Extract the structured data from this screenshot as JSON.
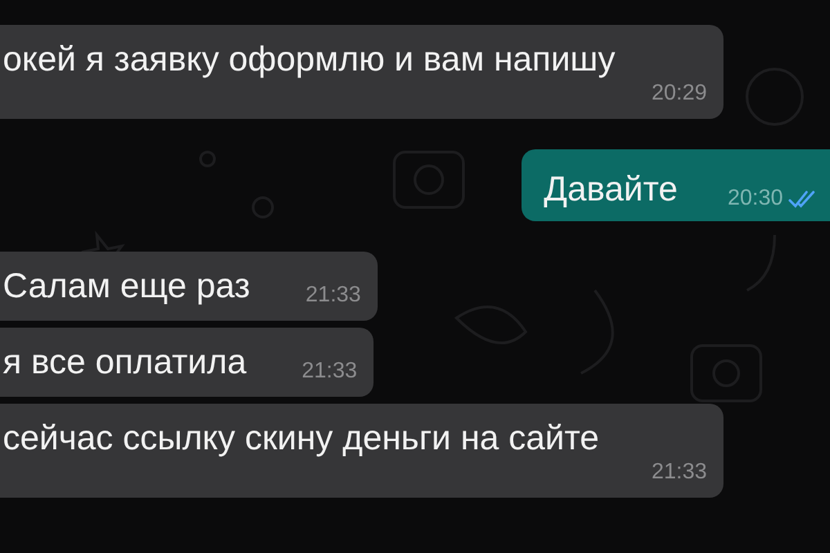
{
  "messages": [
    {
      "outgoing": false,
      "text": "окей я заявку оформлю и вам напишу",
      "time": "20:29"
    },
    {
      "outgoing": true,
      "text": "Давайте",
      "time": "20:30",
      "read": true
    },
    {
      "outgoing": false,
      "text": "Салам еще раз",
      "time": "21:33"
    },
    {
      "outgoing": false,
      "text": "я все оплатила",
      "time": "21:33"
    },
    {
      "outgoing": false,
      "text": "сейчас ссылку скину деньги на сайте",
      "time": "21:33"
    }
  ]
}
